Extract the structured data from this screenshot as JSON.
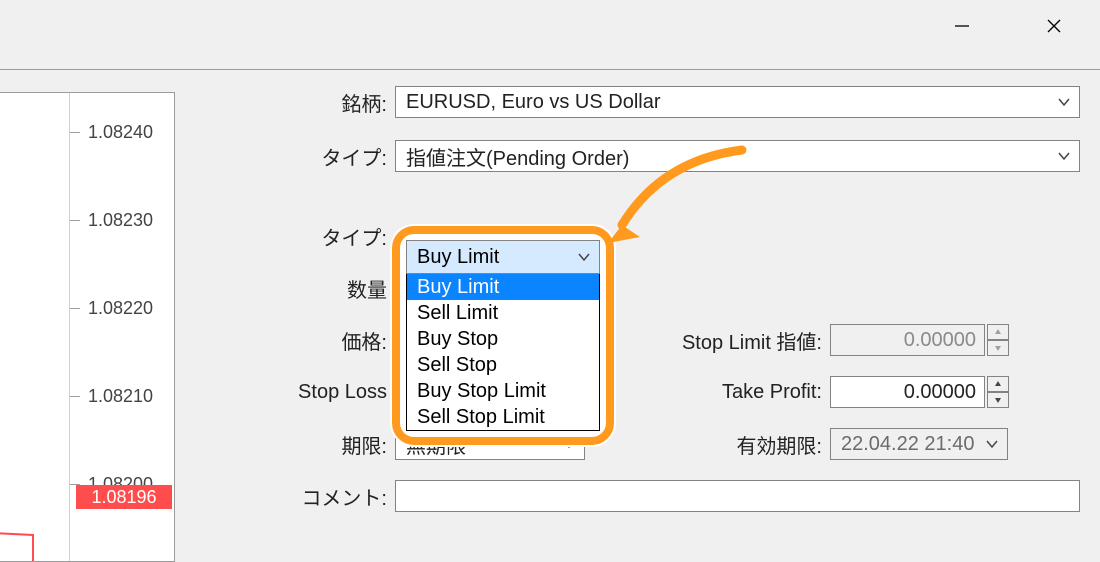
{
  "titlebar": {
    "minimize": "minimize",
    "close": "close"
  },
  "chart": {
    "ticks": [
      "1.08240",
      "1.08230",
      "1.08220",
      "1.08210",
      "1.08200"
    ],
    "price_tag": "1.08196"
  },
  "form": {
    "symbol_label": "銘柄:",
    "symbol_value": "EURUSD, Euro vs US Dollar",
    "order_type_label": "タイプ:",
    "order_type_value": "指値注文(Pending Order)",
    "pending_type_label": "タイプ:",
    "pending_type_value": "Buy Limit",
    "volume_label": "数量",
    "price_label": "価格:",
    "stoploss_label": "Stop Loss",
    "stoplimit_label": "Stop Limit 指値:",
    "stoplimit_value": "0.00000",
    "takeprofit_label": "Take Profit:",
    "takeprofit_value": "0.00000",
    "expiry_type_label": "期限:",
    "expiry_type_value": "無期限",
    "expiry_date_label": "有効期限:",
    "expiry_date_value": "22.04.22 21:40",
    "comment_label": "コメント:"
  },
  "dropdown": {
    "selected": "Buy Limit",
    "items": [
      "Buy Limit",
      "Sell Limit",
      "Buy Stop",
      "Sell Stop",
      "Buy Stop Limit",
      "Sell Stop Limit"
    ]
  }
}
